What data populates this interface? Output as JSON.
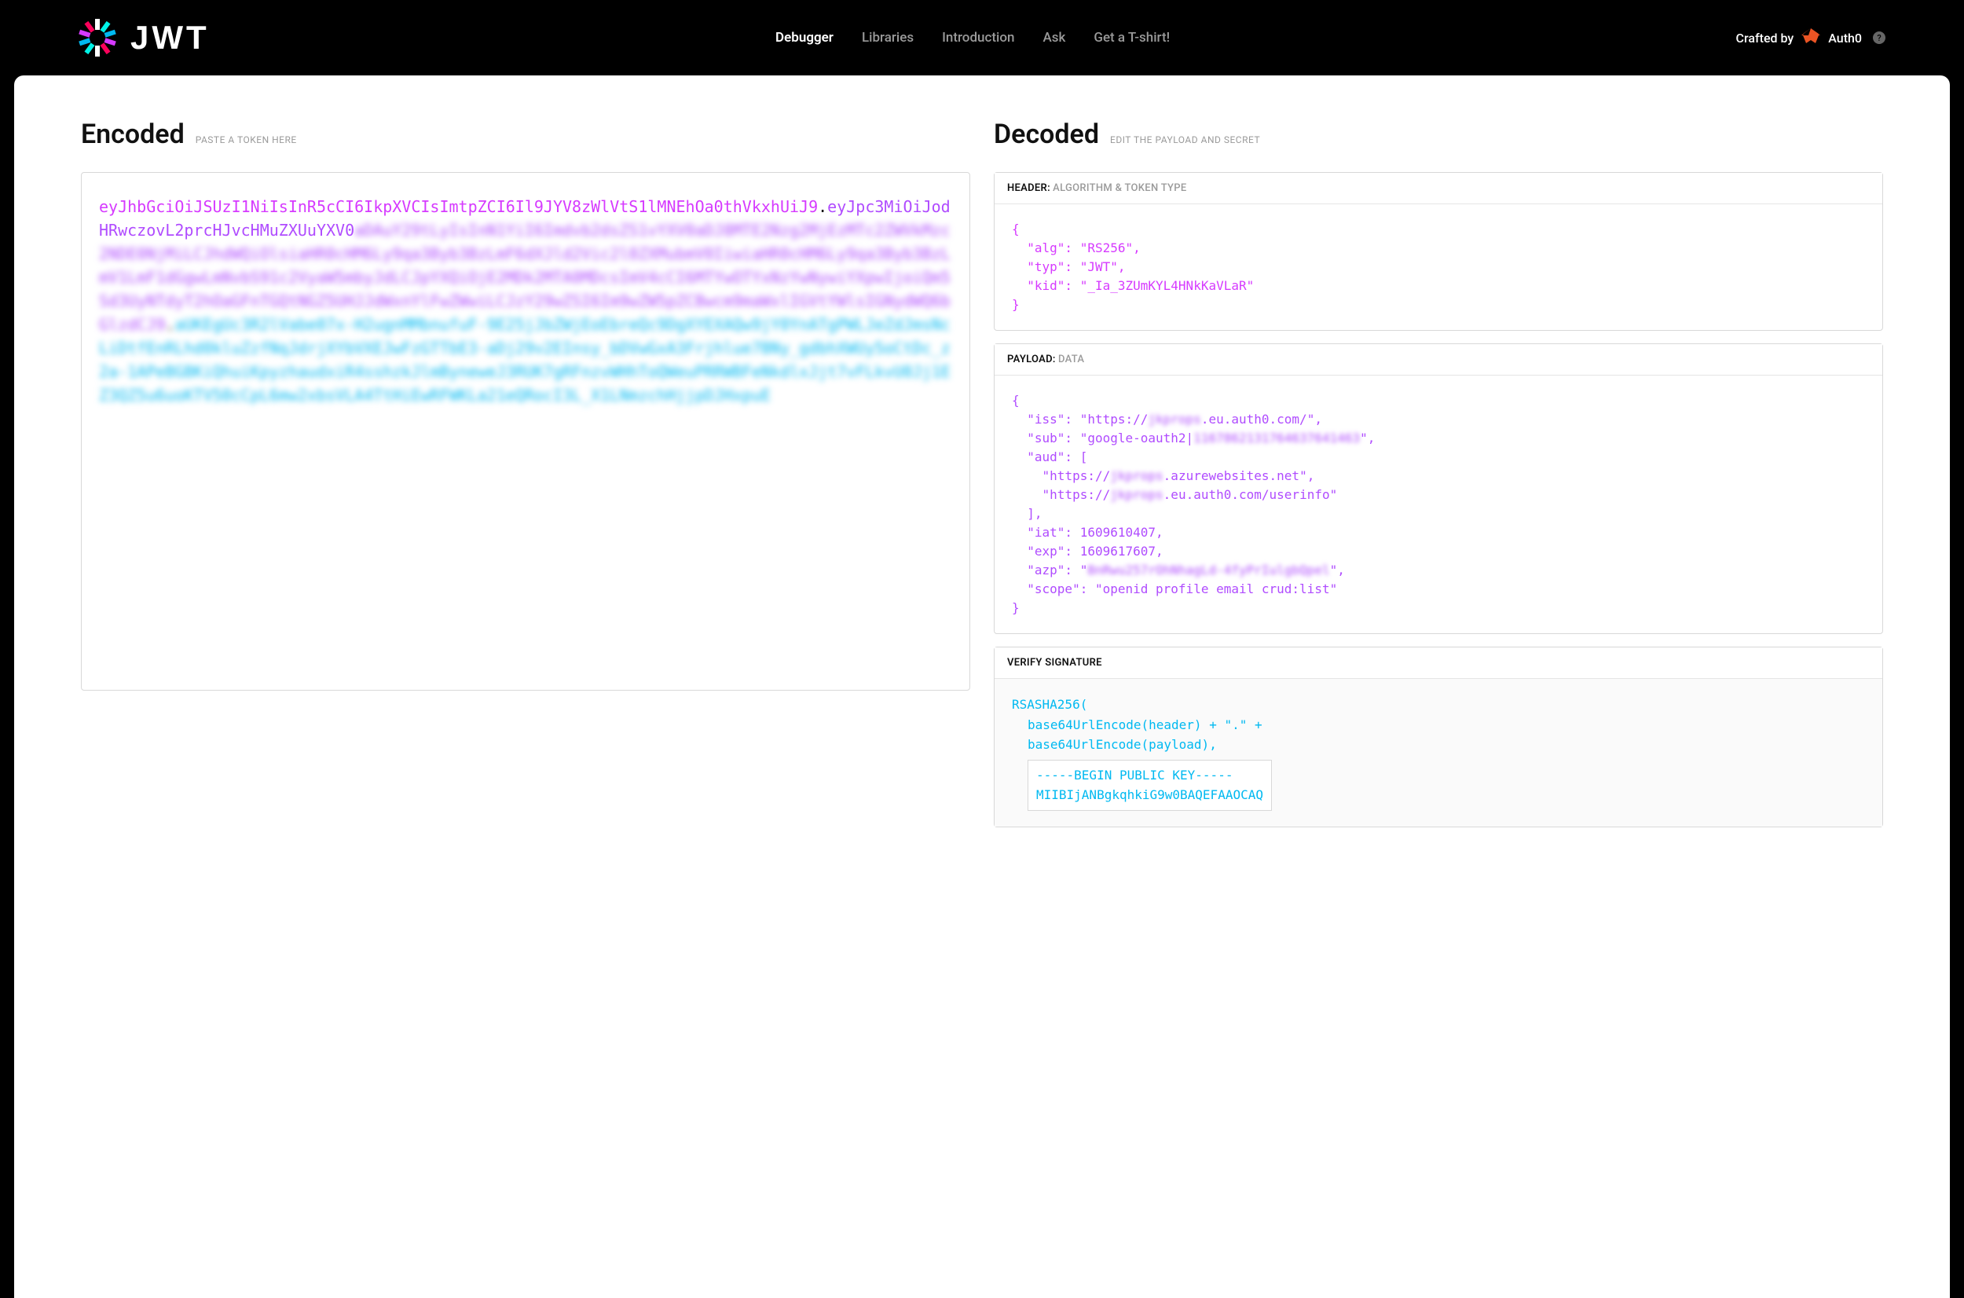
{
  "header": {
    "logo_text": "JWT",
    "nav": [
      {
        "label": "Debugger",
        "active": true
      },
      {
        "label": "Libraries",
        "active": false
      },
      {
        "label": "Introduction",
        "active": false
      },
      {
        "label": "Ask",
        "active": false
      },
      {
        "label": "Get a T-shirt!",
        "active": false
      }
    ],
    "crafted_prefix": "Crafted by",
    "crafted_brand": "Auth0"
  },
  "encoded": {
    "title": "Encoded",
    "hint": "PASTE A TOKEN HERE",
    "token_header": "eyJhbGciOiJSUzI1NiIsInR5cCI6IkpXVCIsImtpZCI6Il9JYV8zWlVtS1lMNEhOa0thVkxhUiJ9",
    "token_payload_start": "eyJpc3MiOiJodHRwczovL2prcHJvcHMuZXUuYXV0",
    "token_payload_blur": "aDAuY29tLyIsInN1YiI6Imdvb2dsZS1vYXV0aDJ8MTE2Nzg2MjEzMTc2ZWVkMzc2NDE0NjMiLCJhdWQiOlsiaHR0cHM6Ly9qa3Byb3BzLmF6dXJld2Vic2l0ZXMubmV0IiwiaHR0cHM6Ly9qa3Byb3BzLmV1LmF1dGgwLmNvbS91c2VyaW5mbyJdLCJpYXQiOjE2MDk2MTA0MDcsImV4cCI6MTYwOTYxNzYwNywiYXpwIjoiQm5Sd3UyNTdyT2hOaGFnTGQtNGZ5UHJJdWxnYlFwZWwiLCJzY29wZSI6Im9wZW5pZCBwcm9maWxlIGVtYWlsIGNydWQ6bGlzdCJ9",
    "token_sig_blur": "aUKEgUc3R2lVabe07x-H2ugnMMbnufuF-9E25jJbZWjEoEbreQc9DgXYEXAQw9jY0YnATgPWLJeZdJmsNcLiDtfEnRLhd0kluZzfNqJdrjXYbVXEJwFzGTTbE3-aDj29v2EInsy_bDVwGxA3Frjhlue7BNy_gdbhXWUy5oCtDc_z2a-1APeBGBKiQhuiKpyzhaudxiR4sshzkJlmByneweJ3RUK7gRFnzvWHhToQWeuPRRWBFeNkdlxJjt7vFLkvU0Jj1EZ3QZ5u6uoKTV50cCpL6mw2xbsVLA4TtHiEwRFWKLa21eQRocI3L_X1LNmzchHjjpDJHxpuE"
  },
  "decoded": {
    "title": "Decoded",
    "hint": "EDIT THE PAYLOAD AND SECRET",
    "header_section": {
      "label": "HEADER:",
      "sub": "ALGORITHM & TOKEN TYPE",
      "json_lines": [
        "{",
        "  \"alg\": \"RS256\",",
        "  \"typ\": \"JWT\",",
        "  \"kid\": \"_Ia_3ZUmKYL4HNkKaVLaR\"",
        "}"
      ]
    },
    "payload_section": {
      "label": "PAYLOAD:",
      "sub": "DATA",
      "iss_prefix": "https://",
      "iss_blur": "jkprops",
      "iss_suffix": ".eu.auth0.com/",
      "sub_prefix": "google-oauth2|",
      "sub_blur": "1167862131764637641463",
      "aud0_prefix": "https://",
      "aud0_blur": "jkprops",
      "aud0_suffix": ".azurewebsites.net",
      "aud1_prefix": "https://",
      "aud1_blur": "jkprops",
      "aud1_suffix": ".eu.auth0.com/userinfo",
      "iat": 1609610407,
      "exp": 1609617607,
      "azp_blur": "BnRwu257rOhNhagLd-4fyPrIulgbQpel",
      "scope": "openid profile email crud:list"
    },
    "verify_section": {
      "label": "VERIFY SIGNATURE",
      "lines": [
        "RSASHA256(",
        "base64UrlEncode(header) + \".\" +",
        "base64UrlEncode(payload),"
      ],
      "key_lines": [
        "-----BEGIN PUBLIC KEY-----",
        "MIIBIjANBgkqhkiG9w0BAQEFAAOCAQ"
      ]
    }
  }
}
